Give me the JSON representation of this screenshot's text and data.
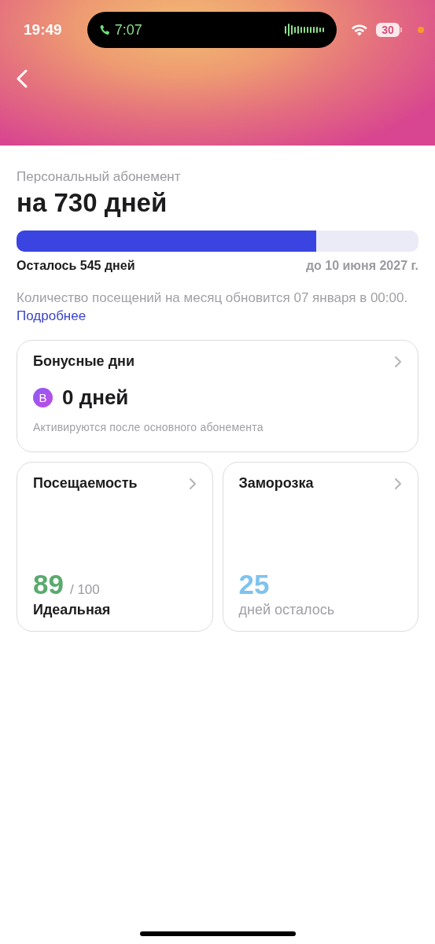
{
  "status_bar": {
    "time": "19:49",
    "call_time": "7:07",
    "battery": "30"
  },
  "subscription": {
    "caption": "Персональный абонемент",
    "title": "на 730 дней",
    "level": 0.745,
    "remaining": "Осталось 545 дней",
    "until": "до 10 июня 2027 г.",
    "note": "Количество посещений на месяц обновится 07 января в 00:00.",
    "link": "Подробнее"
  },
  "bonus_card": {
    "title": "Бонусные дни",
    "badge": "B",
    "value": "0 дней",
    "hint": "Активируются после основного абонемента"
  },
  "stat_cards": [
    {
      "kind": "score",
      "title": "Посещаемость",
      "value": "89",
      "total": "/ 100",
      "label": "Идеальная",
      "color": "#5aaa6e"
    },
    {
      "kind": "count",
      "title": "Заморозка",
      "value": "25",
      "label": "дней осталось",
      "color": "#7ec3ee"
    }
  ]
}
